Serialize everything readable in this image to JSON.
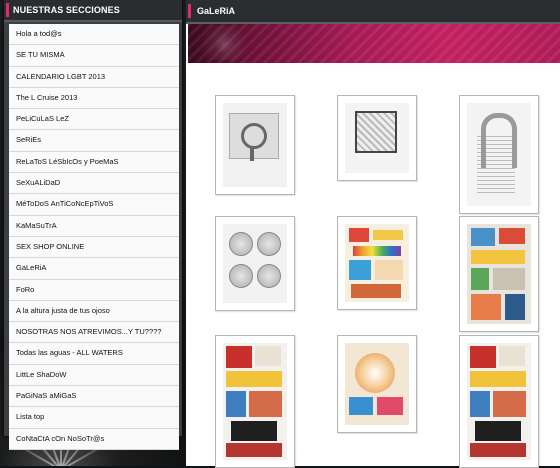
{
  "sidebar": {
    "title": "NUESTRAS SECCIONES",
    "items": [
      {
        "label": "Hola a tod@s"
      },
      {
        "label": "SE TU MISMA"
      },
      {
        "label": "CALENDARIO LGBT 2013"
      },
      {
        "label": "The L Cruise 2013"
      },
      {
        "label": "PeLiCuLaS LeZ"
      },
      {
        "label": "SeRiEs"
      },
      {
        "label": "ReLaToS LéSbIcOs y PoeMaS"
      },
      {
        "label": "SeXuALiDaD"
      },
      {
        "label": "MéToDoS AnTiCoNcEpTiVoS"
      },
      {
        "label": "KaMaSuTrA"
      },
      {
        "label": "SEX SHOP ONLINE"
      },
      {
        "label": "GaLeRiA"
      },
      {
        "label": "FoRo"
      },
      {
        "label": "A la altura justa de tus ojoso"
      },
      {
        "label": "NOSOTRAS NOS ATREVIMOS...Y TU????"
      },
      {
        "label": "Todas las aguas - ALL WATERS"
      },
      {
        "label": "LittLe ShaDoW"
      },
      {
        "label": "PaGiNaS aMiGaS"
      },
      {
        "label": "Lista top"
      },
      {
        "label": "CoNtaCtA cOn NoSoTr@s"
      }
    ]
  },
  "panel": {
    "title": "GaLeRiA"
  },
  "colors": {
    "accent": "#e02b66",
    "header_bg": "#2b2e30",
    "sidebar_bg": "#3c4042",
    "banner": "#c2205f"
  },
  "gallery": {
    "thumbnails": [
      {
        "name": "gallery-thumb-1",
        "icon": "emblem-artwork"
      },
      {
        "name": "gallery-thumb-2",
        "icon": "framed-artwork"
      },
      {
        "name": "gallery-thumb-3",
        "icon": "arch-artwork"
      },
      {
        "name": "gallery-thumb-4",
        "icon": "coins-artwork"
      },
      {
        "name": "gallery-thumb-5",
        "icon": "collage-artwork"
      },
      {
        "name": "gallery-thumb-6",
        "icon": "collage-artwork"
      },
      {
        "name": "gallery-thumb-7",
        "icon": "collage-artwork"
      },
      {
        "name": "gallery-thumb-8",
        "icon": "collage-artwork"
      },
      {
        "name": "gallery-thumb-9",
        "icon": "collage-artwork"
      }
    ]
  }
}
